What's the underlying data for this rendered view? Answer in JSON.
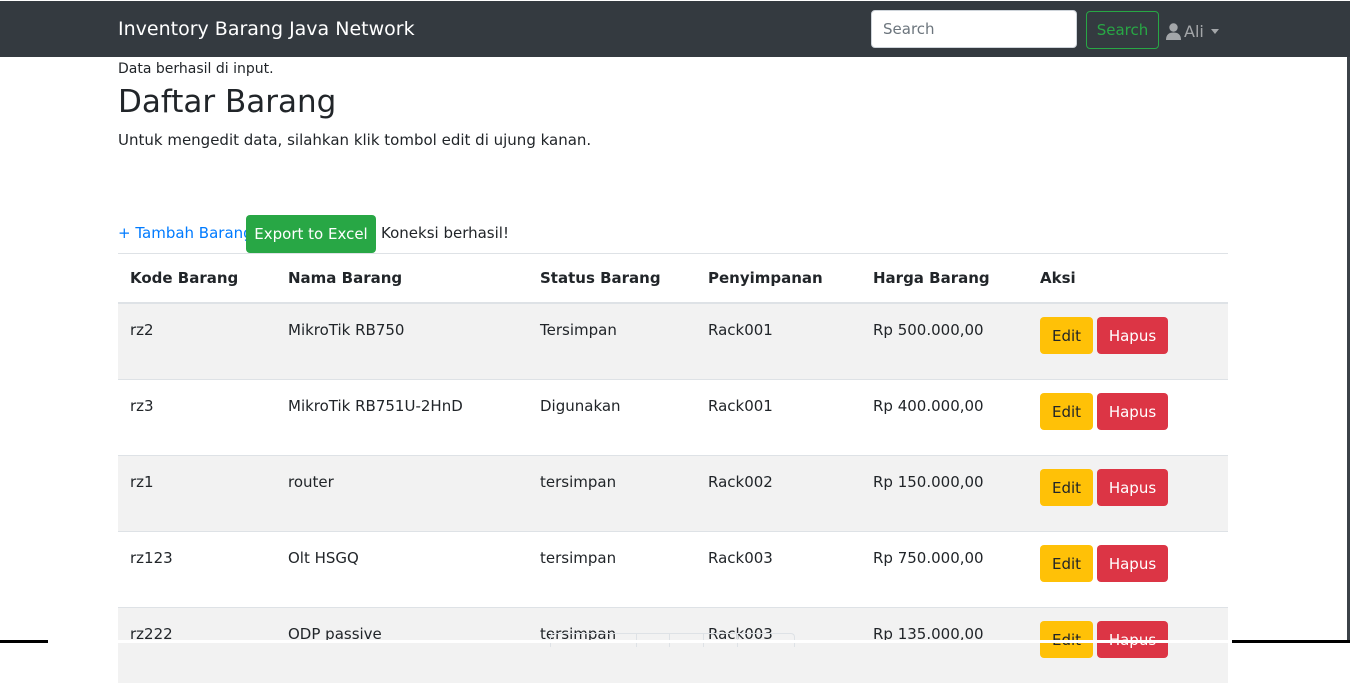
{
  "navbar": {
    "brand": "Inventory Barang Java Network",
    "search_placeholder": "Search",
    "search_button": "Search",
    "user_icon": "user-icon",
    "user_name": "Ali"
  },
  "content": {
    "flash_message": "Data berhasil di input.",
    "title": "Daftar Barang",
    "intro": "Untuk mengedit data, silahkan klik tombol edit di ujung kanan.",
    "add_link": "+ Tambah Barang",
    "export_button": "Export to Excel",
    "connection_status": "Koneksi berhasil!"
  },
  "table": {
    "headers": [
      "Kode Barang",
      "Nama Barang",
      "Status Barang",
      "Penyimpanan",
      "Harga Barang",
      "Aksi"
    ],
    "rows": [
      {
        "kode": "rz2",
        "nama": "MikroTik RB750",
        "status": "Tersimpan",
        "penyimpanan": "Rack001",
        "harga": "Rp 500.000,00"
      },
      {
        "kode": "rz3",
        "nama": "MikroTik RB751U-2HnD",
        "status": "Digunakan",
        "penyimpanan": "Rack001",
        "harga": "Rp 400.000,00"
      },
      {
        "kode": "rz1",
        "nama": "router",
        "status": "tersimpan",
        "penyimpanan": "Rack002",
        "harga": "Rp 150.000,00"
      },
      {
        "kode": "rz123",
        "nama": "Olt HSGQ",
        "status": "tersimpan",
        "penyimpanan": "Rack003",
        "harga": "Rp 750.000,00"
      },
      {
        "kode": "rz222",
        "nama": "ODP passive",
        "status": "tersimpan",
        "penyimpanan": "Rack003",
        "harga": "Rp 135.000,00"
      }
    ],
    "edit_label": "Edit",
    "delete_label": "Hapus"
  },
  "colors": {
    "navbar": "#343a40",
    "success": "#28a745",
    "warning": "#ffc107",
    "danger": "#dc3545",
    "link": "#007bff",
    "stripe": "#f2f2f2"
  }
}
